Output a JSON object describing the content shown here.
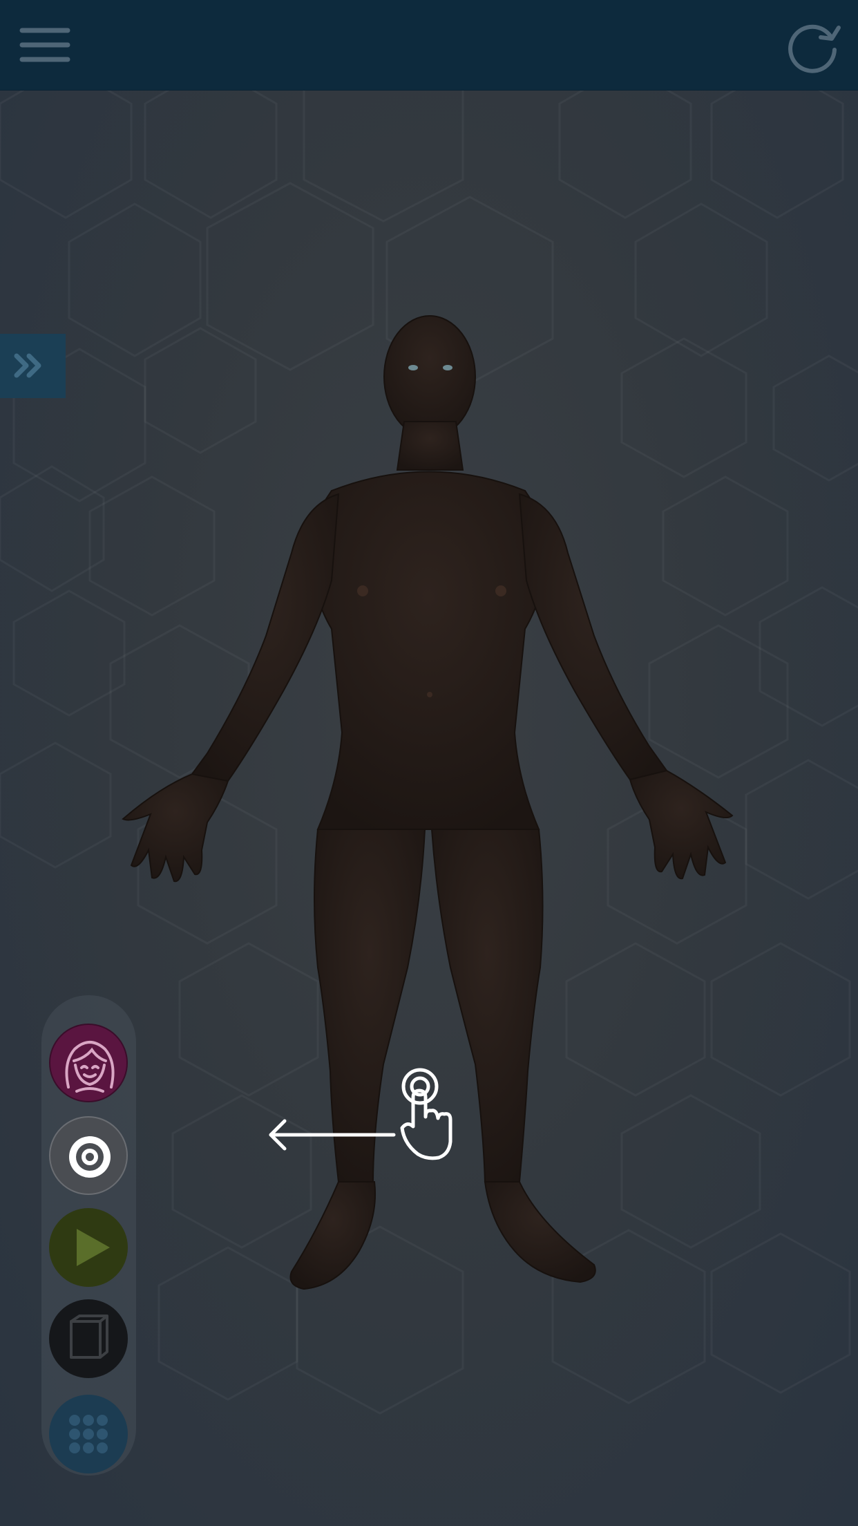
{
  "app": {
    "colors": {
      "topbar": "#0d2a3d",
      "side_toggle": "#1b3f55",
      "avatar_button": "#5a1540",
      "play_button": "#2f3a12",
      "grid_button": "#1c3c52"
    }
  },
  "topbar": {
    "menu_icon": "hamburger-icon",
    "refresh_icon": "refresh-icon"
  },
  "side_panel": {
    "toggle_icon": "double-chevron-right-icon"
  },
  "viewport": {
    "subject": "human-male-3d-model",
    "gesture_hint_icon": "swipe-left-hand-icon"
  },
  "dock": {
    "items": [
      {
        "icon": "female-avatar-icon"
      },
      {
        "icon": "target-icon"
      },
      {
        "icon": "play-icon"
      },
      {
        "icon": "book-icon"
      },
      {
        "icon": "grid-dots-icon"
      }
    ]
  }
}
